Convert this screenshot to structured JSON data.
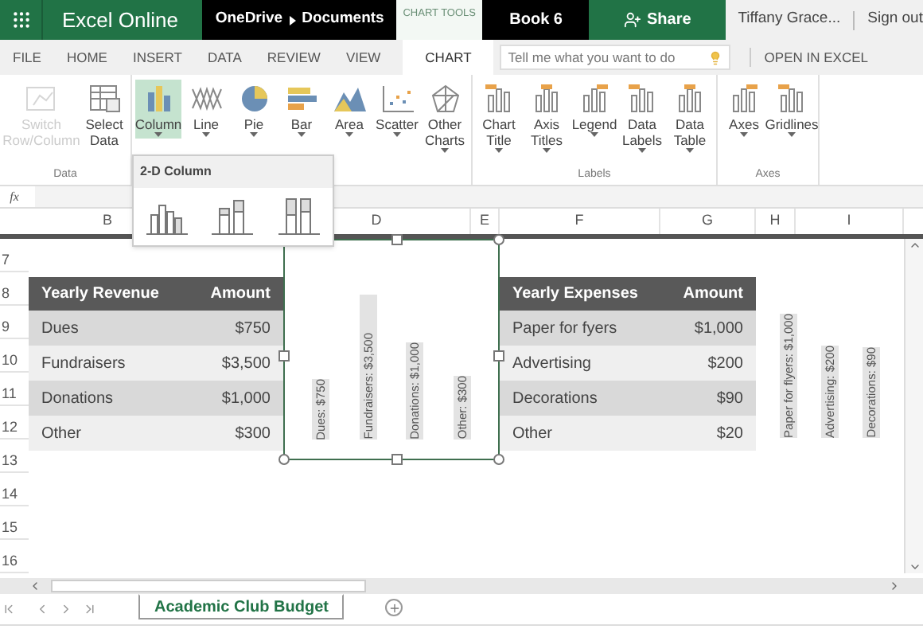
{
  "top_bar": {
    "app_name": "Excel Online",
    "breadcrumb": [
      "OneDrive",
      "Documents"
    ],
    "context_label": "CHART TOOLS",
    "file_name": "Book 6",
    "share": "Share",
    "user": "Tiffany Grace...",
    "sign_out": "Sign out"
  },
  "tabs": [
    {
      "label": "FILE",
      "selected": false
    },
    {
      "label": "HOME",
      "selected": false
    },
    {
      "label": "INSERT",
      "selected": false
    },
    {
      "label": "DATA",
      "selected": false
    },
    {
      "label": "REVIEW",
      "selected": false
    },
    {
      "label": "VIEW",
      "selected": false
    },
    {
      "label": "CHART",
      "selected": true
    }
  ],
  "search": {
    "placeholder": "Tell me what you want to do"
  },
  "open_in_excel": "OPEN IN EXCEL",
  "ribbon_groups": [
    {
      "label": "Data",
      "buttons": [
        {
          "label": "Switch Row/Column",
          "disabled": true,
          "selected": false,
          "dropdown": false
        },
        {
          "label": "Select Data",
          "disabled": false,
          "selected": false,
          "dropdown": false
        }
      ]
    },
    {
      "buttons": [
        {
          "label": "Column",
          "disabled": false,
          "selected": true,
          "dropdown": true
        },
        {
          "label": "Line",
          "disabled": false,
          "selected": false,
          "dropdown": true
        },
        {
          "label": "Pie",
          "disabled": false,
          "selected": false,
          "dropdown": true
        },
        {
          "label": "Bar",
          "disabled": false,
          "selected": false,
          "dropdown": true
        },
        {
          "label": "Area",
          "disabled": false,
          "selected": false,
          "dropdown": true
        },
        {
          "label": "Scatter",
          "disabled": false,
          "selected": false,
          "dropdown": true
        },
        {
          "label": "Other Charts",
          "disabled": false,
          "selected": false,
          "dropdown": true
        }
      ]
    },
    {
      "label": "Labels",
      "buttons": [
        {
          "label": "Chart Title",
          "disabled": false,
          "selected": false,
          "dropdown": true
        },
        {
          "label": "Axis Titles",
          "disabled": false,
          "selected": false,
          "dropdown": true
        },
        {
          "label": "Legend",
          "disabled": false,
          "selected": false,
          "dropdown": true
        },
        {
          "label": "Data Labels",
          "disabled": false,
          "selected": false,
          "dropdown": true
        },
        {
          "label": "Data Table",
          "disabled": false,
          "selected": false,
          "dropdown": true
        }
      ]
    },
    {
      "label": "Axes",
      "buttons": [
        {
          "label": "Axes",
          "disabled": false,
          "selected": false,
          "dropdown": true
        },
        {
          "label": "Gridlines",
          "disabled": false,
          "selected": false,
          "dropdown": true
        }
      ]
    }
  ],
  "column_menu": {
    "title": "2-D Column"
  },
  "formula_bar": {
    "label": "fx"
  },
  "columns": [
    {
      "label": "B"
    },
    {},
    {
      "label": "D"
    },
    {
      "label": "E"
    },
    {
      "label": "F"
    },
    {
      "label": "G"
    },
    {
      "label": "H"
    },
    {
      "label": "I"
    }
  ],
  "rows": [
    "7",
    "8",
    "9",
    "10",
    "11",
    "12",
    "13",
    "14",
    "15",
    "16"
  ],
  "revenue_table": {
    "header": [
      "Yearly Revenue",
      "Amount"
    ],
    "rows": [
      [
        "Dues",
        "$750"
      ],
      [
        "Fundraisers",
        "$3,500"
      ],
      [
        "Donations",
        "$1,000"
      ],
      [
        "Other",
        "$300"
      ]
    ]
  },
  "expenses_table": {
    "header": [
      "Yearly Expenses",
      "Amount"
    ],
    "rows": [
      [
        "Paper for fyers",
        "$1,000"
      ],
      [
        "Advertising",
        "$200"
      ],
      [
        "Decorations",
        "$90"
      ],
      [
        "Other",
        "$20"
      ]
    ]
  },
  "charts": [
    {
      "selected": true,
      "labels": [
        "Dues: $750",
        "Fundraisers: $3,500",
        "Donations: $1,000",
        "Other: $300"
      ]
    },
    {
      "selected": false,
      "labels": [
        "Paper for flyers: $1,000",
        "Advertising: $200",
        "Decorations: $90"
      ]
    }
  ],
  "sheet_tabs": [
    {
      "label": "Academic Club Budget",
      "selected": true
    }
  ]
}
